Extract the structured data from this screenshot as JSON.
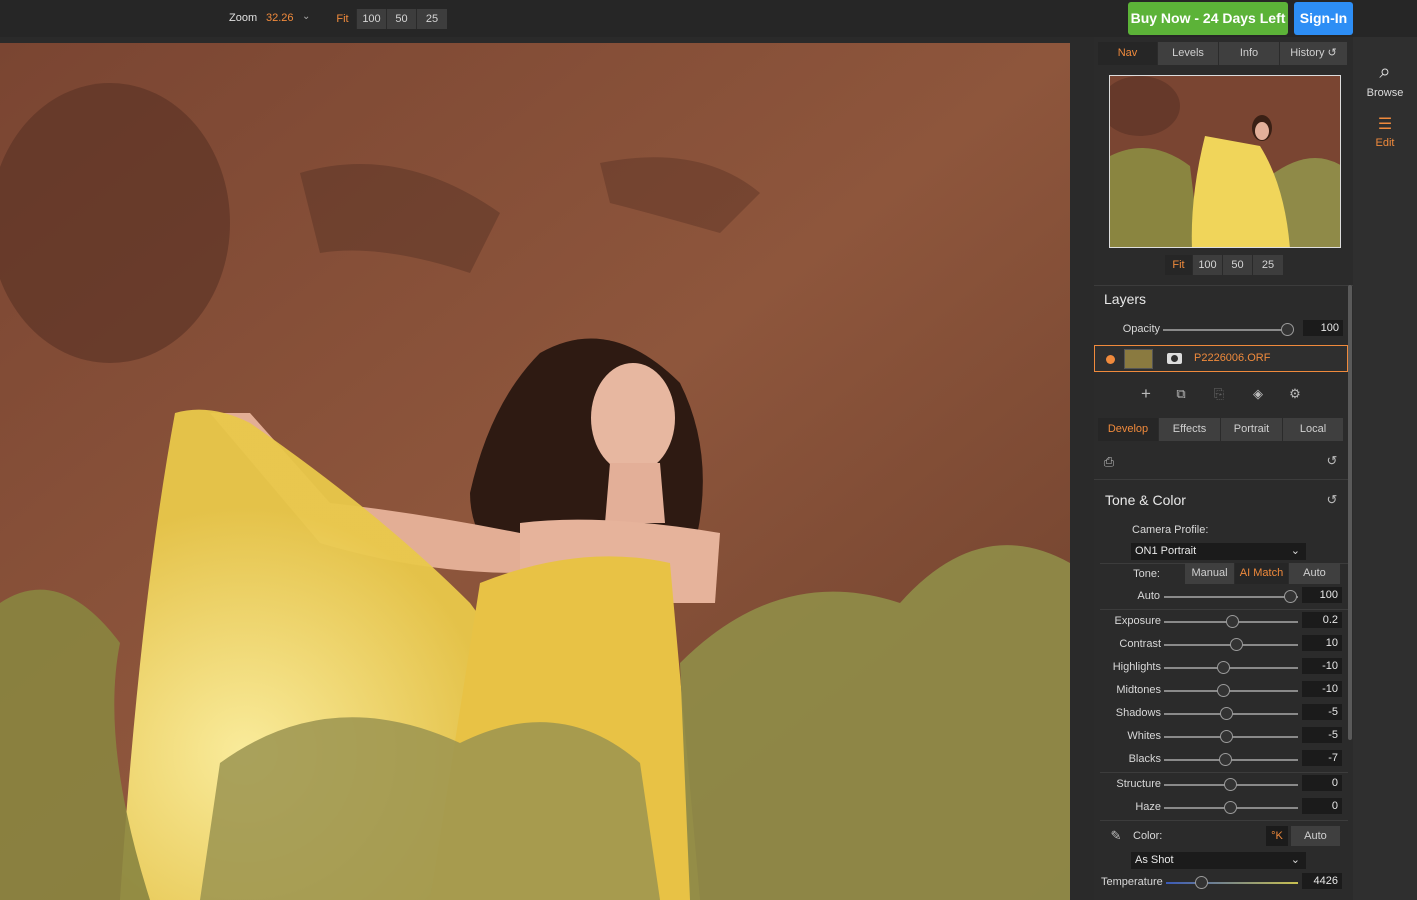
{
  "topbar": {
    "zoom_label": "Zoom",
    "zoom_value": "32.26",
    "zoom_buttons": [
      "Fit",
      "100",
      "50",
      "25"
    ],
    "buy_label": "Buy Now - 24 Days Left",
    "signin_label": "Sign-In"
  },
  "nav": {
    "tabs": [
      "Nav",
      "Levels",
      "Info",
      "History"
    ],
    "zoom_buttons": [
      "Fit",
      "100",
      "50",
      "25"
    ]
  },
  "layers": {
    "title": "Layers",
    "opacity_label": "Opacity",
    "opacity_value": "100",
    "layer_name": "P2226006.ORF"
  },
  "module_tabs": [
    "Develop",
    "Effects",
    "Portrait",
    "Local"
  ],
  "tone_color": {
    "title": "Tone & Color",
    "camera_profile_label": "Camera Profile:",
    "camera_profile_value": "ON1 Portrait",
    "tone_label": "Tone:",
    "tone_modes": [
      "Manual",
      "AI Match",
      "Auto"
    ],
    "sliders": [
      {
        "label": "Auto",
        "value": "100"
      },
      {
        "label": "Exposure",
        "value": "0.2"
      },
      {
        "label": "Contrast",
        "value": "10"
      },
      {
        "label": "Highlights",
        "value": "-10"
      },
      {
        "label": "Midtones",
        "value": "-10"
      },
      {
        "label": "Shadows",
        "value": "-5"
      },
      {
        "label": "Whites",
        "value": "-5"
      },
      {
        "label": "Blacks",
        "value": "-7"
      },
      {
        "label": "Structure",
        "value": "0"
      },
      {
        "label": "Haze",
        "value": "0"
      }
    ],
    "color_label": "Color:",
    "kelvin_label": "°K",
    "color_auto": "Auto",
    "white_balance_value": "As Shot",
    "temperature_label": "Temperature",
    "temperature_value": "4426"
  },
  "sidebar": {
    "browse_label": "Browse",
    "edit_label": "Edit"
  },
  "colors": {
    "accent": "#f08a3c",
    "buy": "#5cb338",
    "signin": "#2d8ef5"
  }
}
